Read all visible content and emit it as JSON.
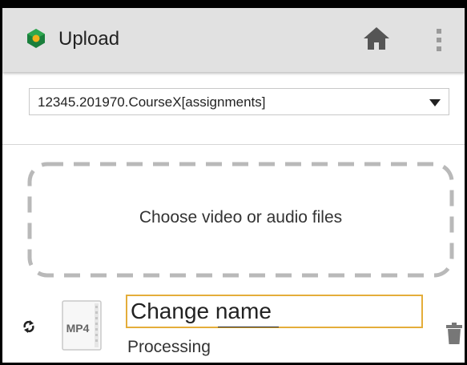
{
  "appbar": {
    "title": "Upload",
    "logo_icon": "kaltura-logo-icon",
    "home_icon": "home-icon",
    "menu_icon": "more-vertical-icon",
    "background": "#e1e1e1"
  },
  "category_select": {
    "selected": "12345.201970.CourseX[assignments]",
    "caret_icon": "caret-down-icon"
  },
  "dropzone": {
    "label": "Choose video or audio files"
  },
  "upload_item": {
    "sync_icon": "refresh-icon",
    "file_type": "MP4",
    "name_placeholder": "Change name",
    "status": "Processing",
    "delete_icon": "trash-icon",
    "accent": "#e4ad3a"
  }
}
